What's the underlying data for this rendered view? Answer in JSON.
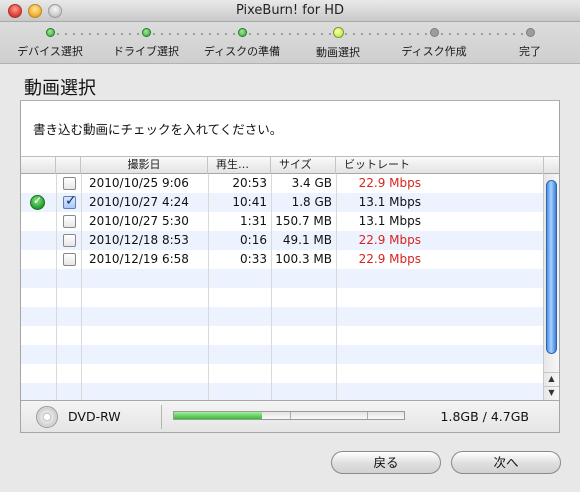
{
  "window": {
    "title": "PixeBurn! for HD"
  },
  "steps": [
    {
      "label": "デバイス選択",
      "state": "done"
    },
    {
      "label": "ドライブ選択",
      "state": "done"
    },
    {
      "label": "ディスクの準備",
      "state": "done"
    },
    {
      "label": "動画選択",
      "state": "current"
    },
    {
      "label": "ディスク作成",
      "state": "pending"
    },
    {
      "label": "完了",
      "state": "pending"
    }
  ],
  "page": {
    "heading": "動画選択",
    "instruction": "書き込む動画にチェックを入れてください。"
  },
  "table": {
    "headers": {
      "status": "",
      "check": "",
      "date": "撮影日",
      "duration": "再生…",
      "size": "サイズ",
      "bitrate": "ビットレート"
    },
    "rows": [
      {
        "date": "2010/10/25 9:06",
        "duration": "20:53",
        "size": "3.4 GB",
        "bitrate": "22.9 Mbps",
        "checked": false,
        "ok": false,
        "bitrate_warning": true
      },
      {
        "date": "2010/10/27 4:24",
        "duration": "10:41",
        "size": "1.8 GB",
        "bitrate": "13.1 Mbps",
        "checked": true,
        "ok": true,
        "bitrate_warning": false
      },
      {
        "date": "2010/10/27 5:30",
        "duration": "1:31",
        "size": "150.7 MB",
        "bitrate": "13.1 Mbps",
        "checked": false,
        "ok": false,
        "bitrate_warning": false
      },
      {
        "date": "2010/12/18 8:53",
        "duration": "0:16",
        "size": "49.1 MB",
        "bitrate": "22.9 Mbps",
        "checked": false,
        "ok": false,
        "bitrate_warning": true
      },
      {
        "date": "2010/12/19 6:58",
        "duration": "0:33",
        "size": "100.3 MB",
        "bitrate": "22.9 Mbps",
        "checked": false,
        "ok": false,
        "bitrate_warning": true
      }
    ]
  },
  "footer": {
    "disc_type": "DVD-RW",
    "capacity": "1.8GB / 4.7GB",
    "capacity_used_fraction": 0.383
  },
  "buttons": {
    "back": "戻る",
    "next": "次へ"
  },
  "colors": {
    "warning_text": "#d9241e",
    "progress_green": "#39b83a",
    "row_alt": "#edf3fe"
  }
}
